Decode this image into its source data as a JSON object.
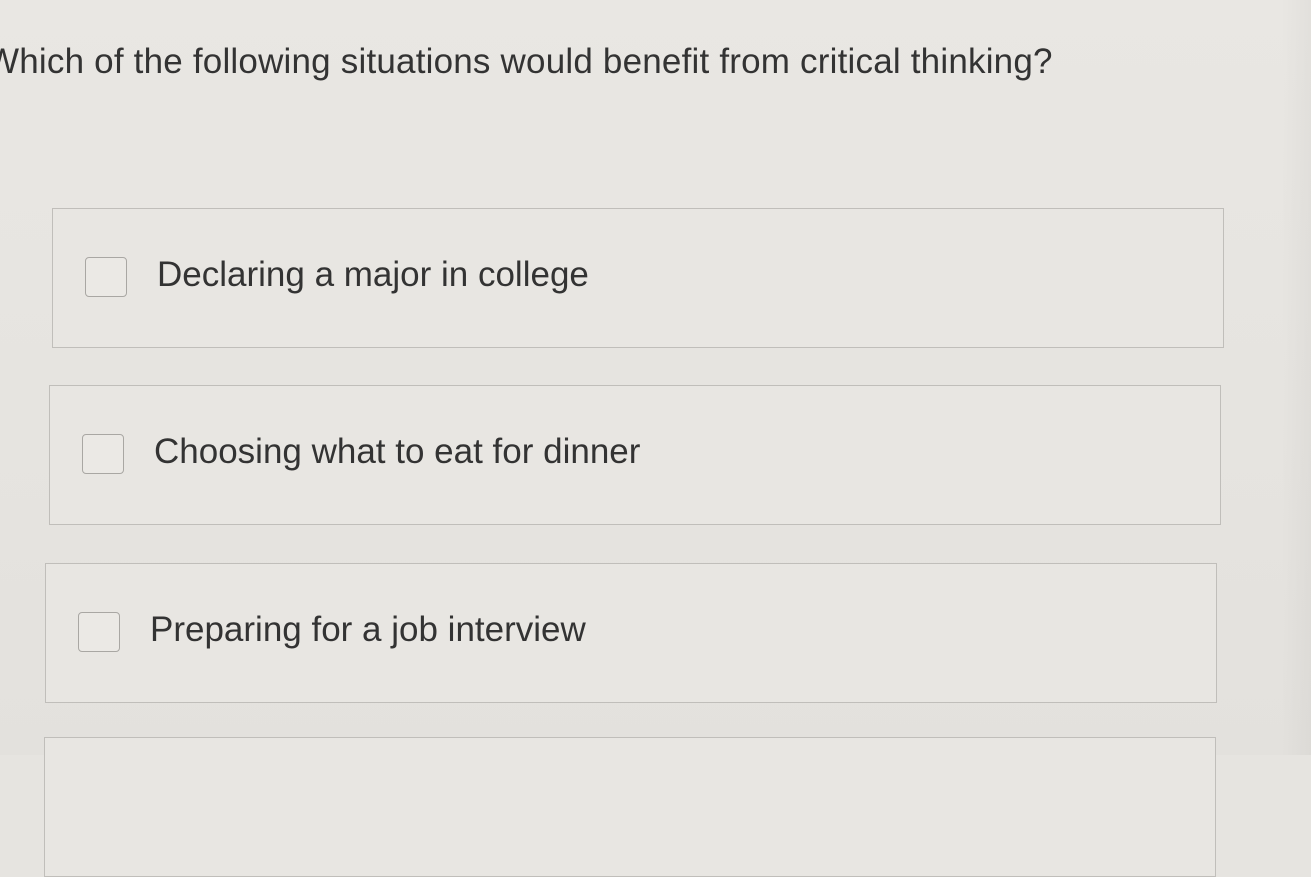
{
  "question": {
    "text": "Which of the following situations would benefit from critical thinking?"
  },
  "options": [
    {
      "label": "Declaring a major in college",
      "checked": false
    },
    {
      "label": "Choosing what to eat for dinner",
      "checked": false
    },
    {
      "label": "Preparing for a job interview",
      "checked": false
    }
  ]
}
